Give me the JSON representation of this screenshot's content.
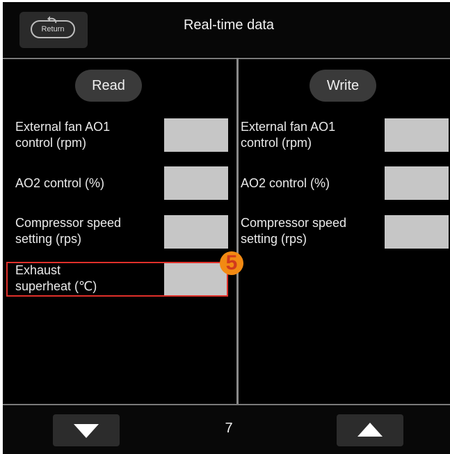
{
  "header": {
    "return_label": "Return",
    "title": "Real-time data"
  },
  "read": {
    "heading": "Read",
    "items": [
      {
        "label_line1": "External fan AO1",
        "label_line2": "control (rpm)",
        "value": ""
      },
      {
        "label_line1": "AO2 control (%)",
        "label_line2": "",
        "value": ""
      },
      {
        "label_line1": "Compressor speed",
        "label_line2": "setting (rps)",
        "value": ""
      },
      {
        "label_line1": "Exhaust",
        "label_line2": "superheat (℃)",
        "value": ""
      }
    ]
  },
  "write": {
    "heading": "Write",
    "items": [
      {
        "label_line1": "External fan AO1",
        "label_line2": "control (rpm)",
        "value": ""
      },
      {
        "label_line1": "AO2 control (%)",
        "label_line2": "",
        "value": ""
      },
      {
        "label_line1": "Compressor speed",
        "label_line2": "setting (rps)",
        "value": ""
      }
    ]
  },
  "annotation": {
    "marker": "5",
    "highlight_color": "#e0302a",
    "marker_color": "#f28a13"
  },
  "footer": {
    "page": "7",
    "down_icon": "triangle-down-icon",
    "up_icon": "triangle-up-icon"
  }
}
